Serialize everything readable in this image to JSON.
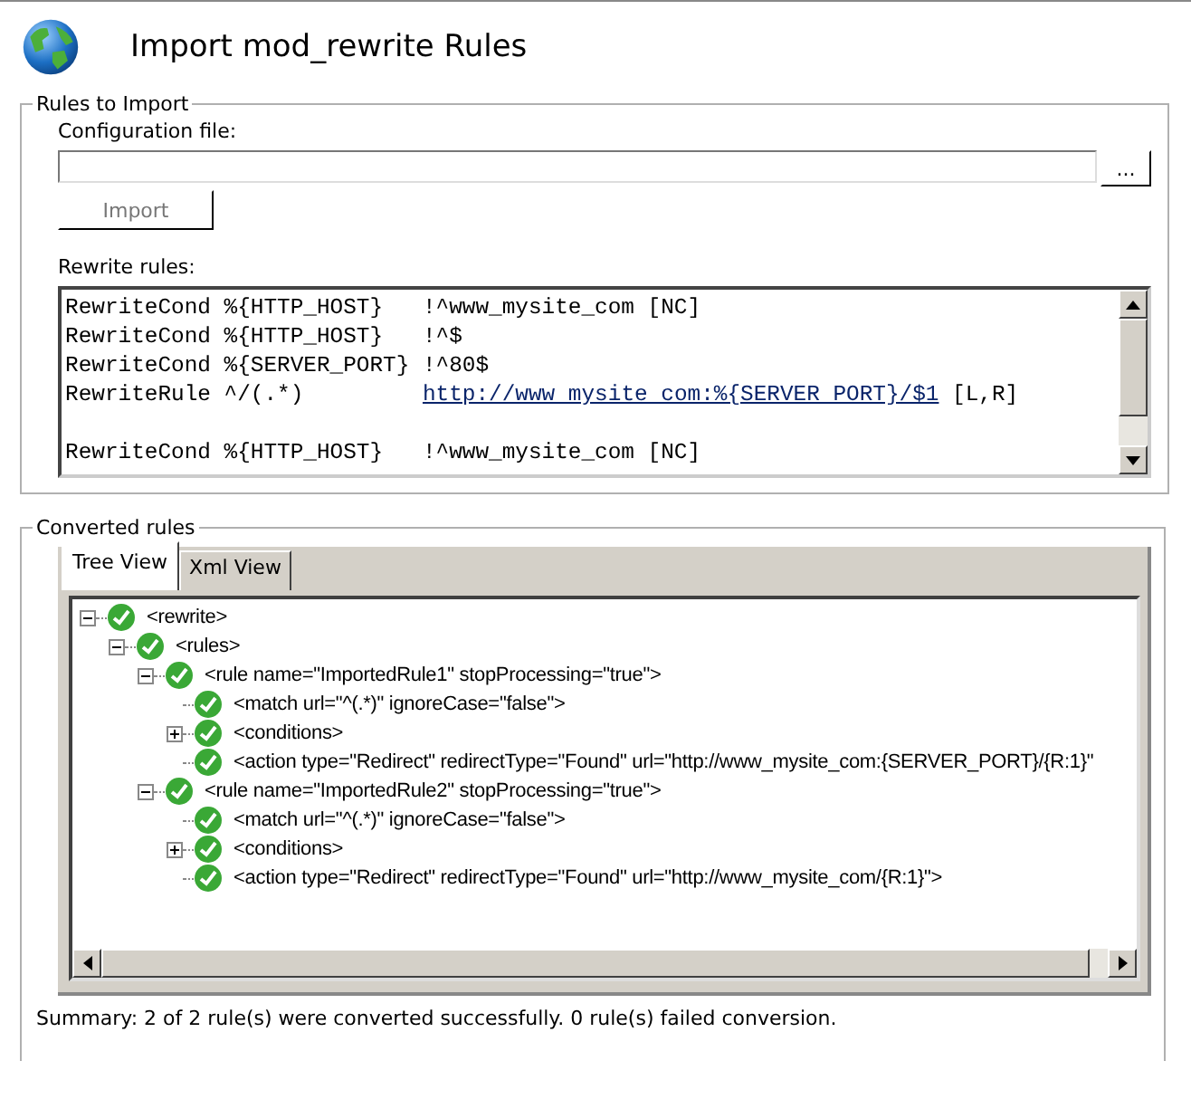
{
  "window": {
    "title": "Import mod_rewrite Rules"
  },
  "rules_to_import": {
    "legend": "Rules to Import",
    "config_label": "Configuration file:",
    "browse_button": "...",
    "import_button": {
      "label": "Import",
      "disabled": true
    },
    "rewrite_label": "Rewrite rules:",
    "rewrite_lines": [
      {
        "parts": [
          {
            "kind": "plain",
            "text": "RewriteCond %{HTTP_HOST}   !^www_mysite_com [NC]"
          }
        ]
      },
      {
        "parts": [
          {
            "kind": "plain",
            "text": "RewriteCond %{HTTP_HOST}   !^$"
          }
        ]
      },
      {
        "parts": [
          {
            "kind": "plain",
            "text": "RewriteCond %{SERVER_PORT} !^80$"
          }
        ]
      },
      {
        "parts": [
          {
            "kind": "plain",
            "text": "RewriteRule ^/(.*)         "
          },
          {
            "kind": "link",
            "text": "http://www mysite com:%{SERVER PORT}/$1"
          },
          {
            "kind": "plain",
            "text": " [L,R]"
          }
        ]
      },
      {
        "kind": "blank"
      },
      {
        "parts": [
          {
            "kind": "plain",
            "text": "RewriteCond %{HTTP_HOST}   !^www_mysite_com [NC]"
          }
        ]
      }
    ]
  },
  "converted_rules": {
    "legend": "Converted rules",
    "tabs": [
      {
        "label": "Tree View",
        "selected": true
      },
      {
        "label": "Xml View",
        "selected": false
      }
    ],
    "tree": [
      {
        "text": "<rewrite>",
        "expanded": true,
        "children": [
          {
            "text": "<rules>",
            "expanded": true,
            "children": [
              {
                "text": "<rule name=\"ImportedRule1\" stopProcessing=\"true\">",
                "expanded": true,
                "children": [
                  {
                    "text": "<match url=\"^(.*)\" ignoreCase=\"false\">"
                  },
                  {
                    "text": "<conditions>",
                    "expanded": false
                  },
                  {
                    "text": "<action type=\"Redirect\" redirectType=\"Found\" url=\"http://www_mysite_com:{SERVER_PORT}/{R:1}\""
                  }
                ]
              },
              {
                "text": "<rule name=\"ImportedRule2\" stopProcessing=\"true\">",
                "expanded": true,
                "children": [
                  {
                    "text": "<match url=\"^(.*)\" ignoreCase=\"false\">"
                  },
                  {
                    "text": "<conditions>",
                    "expanded": false
                  },
                  {
                    "text": "<action type=\"Redirect\" redirectType=\"Found\" url=\"http://www_mysite_com/{R:1}\">"
                  }
                ]
              }
            ]
          }
        ]
      }
    ],
    "summary": "Summary: 2 of 2 rule(s) were converted successfully. 0 rule(s) failed conversion."
  }
}
